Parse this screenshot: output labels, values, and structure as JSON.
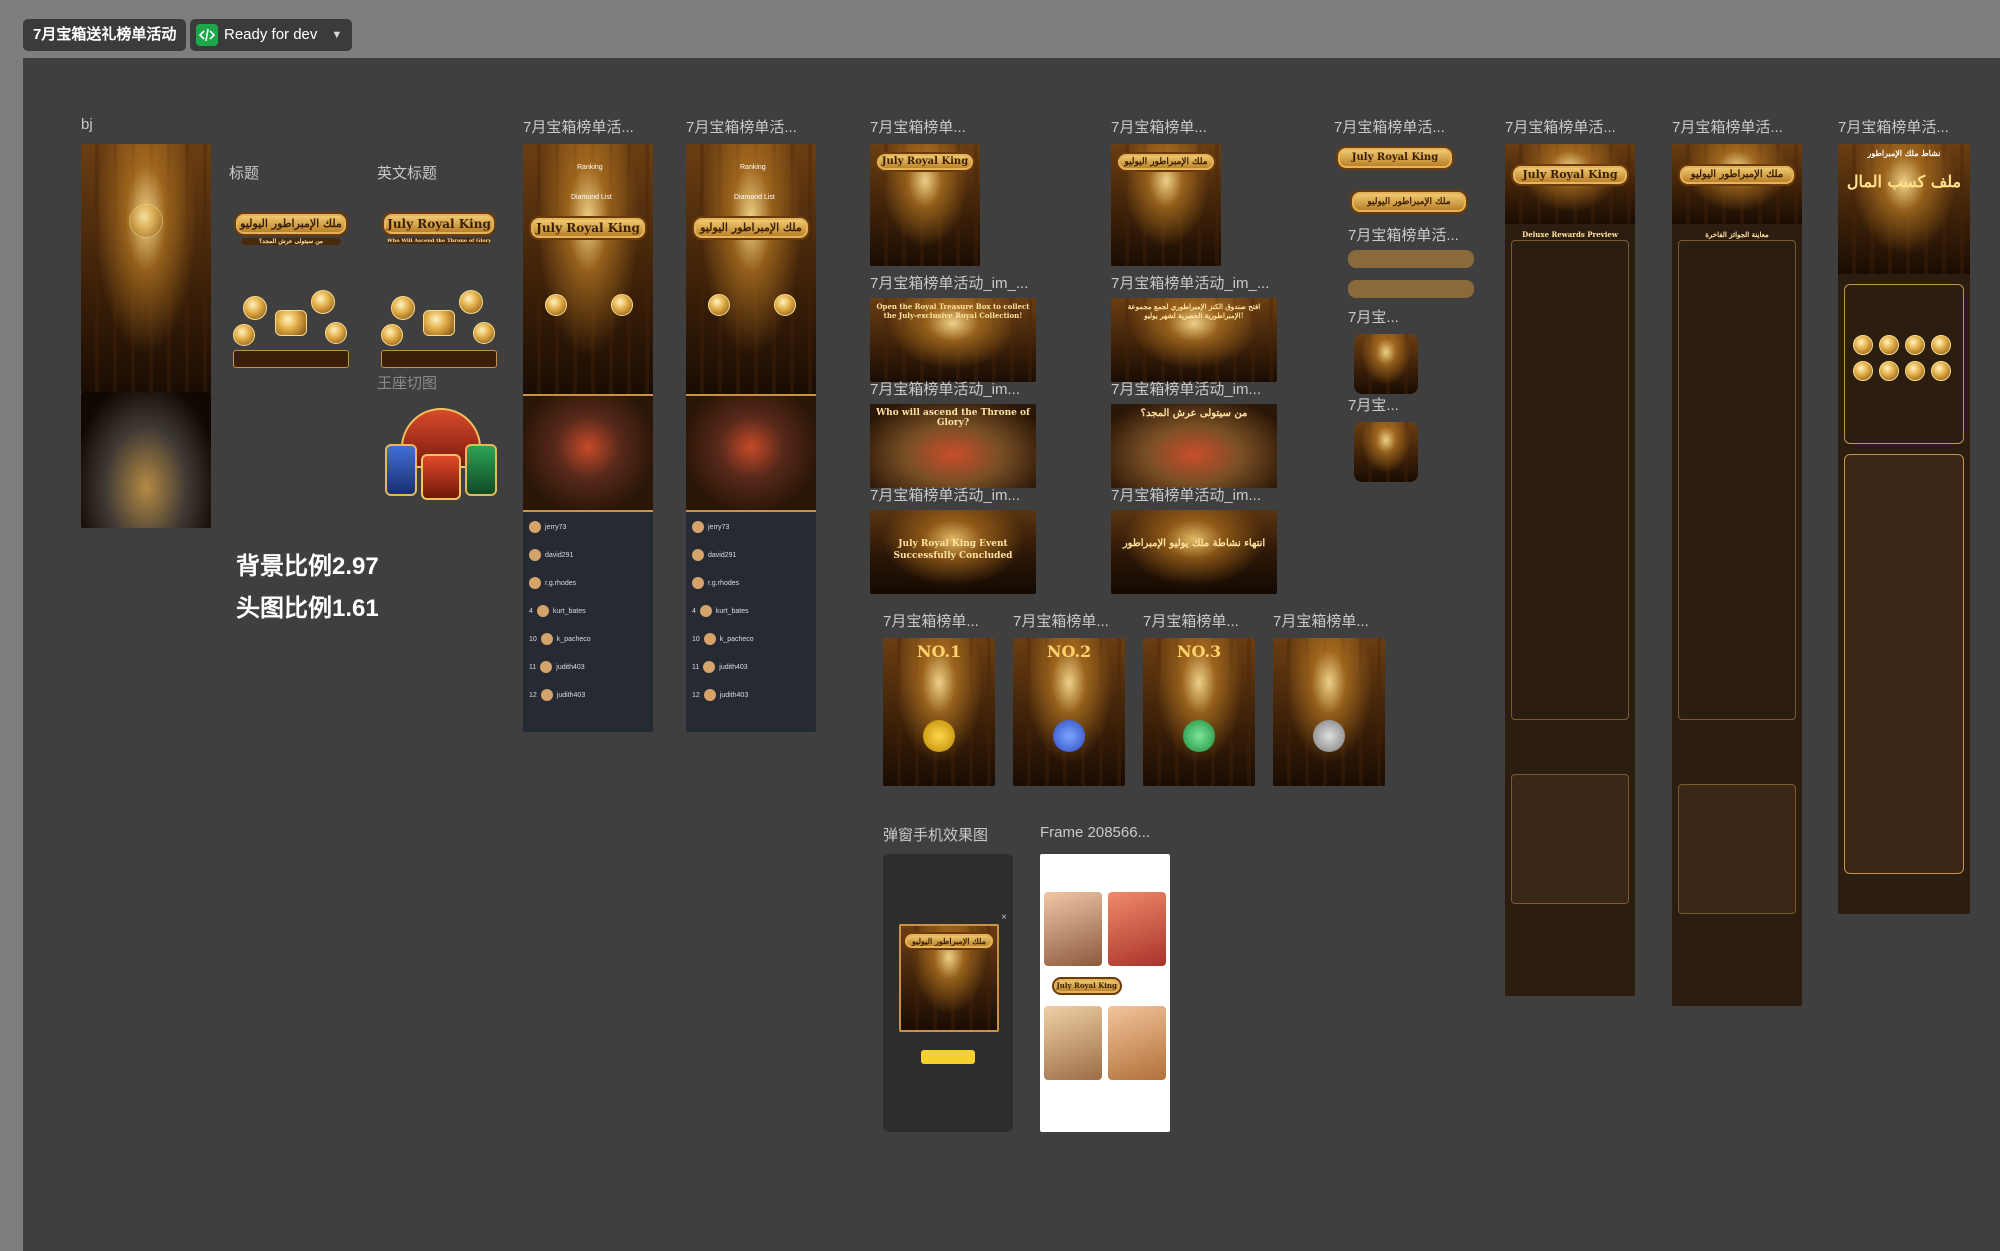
{
  "header": {
    "page_name": "7月宝箱送礼榜单活动",
    "status": "Ready for dev"
  },
  "colors": {
    "toolbar_bg": "#7e7e7e",
    "canvas_bg": "#3f3f3f",
    "chip_bg": "#3b3b3b",
    "status_green": "#1fa84a",
    "gold": "#e4b04a"
  },
  "labels": {
    "bj": "bj",
    "title_cn": "标题",
    "title_en": "英文标题",
    "throne": "王座切图",
    "bg_ratio": "背景比例2.97",
    "head_ratio": "头图比例1.61",
    "f1": "7月宝箱榜单活...",
    "f2": "7月宝箱榜单活...",
    "f3": "7月宝箱榜单...",
    "f4": "7月宝箱榜单...",
    "f5": "7月宝箱榜单活...",
    "f6": "7月宝箱榜单活...",
    "f7": "7月宝箱榜单活...",
    "f8": "7月宝箱榜单活...",
    "im1": "7月宝箱榜单活动_im_...",
    "im2": "7月宝箱榜单活动_im_...",
    "im3": "7月宝箱榜单活动_im...",
    "im4": "7月宝箱榜单活动_im...",
    "im5": "7月宝箱榜单活动_im...",
    "im6": "7月宝箱榜单活动_im...",
    "small1": "7月宝箱榜单活...",
    "small2": "7月宝箱榜单活...",
    "small3": "7月宝...",
    "small4": "7月宝...",
    "rank1_lbl": "7月宝箱榜单...",
    "rank2_lbl": "7月宝箱榜单...",
    "rank3_lbl": "7月宝箱榜单...",
    "rank4_lbl": "7月宝箱榜单...",
    "popup_lbl": "弹窗手机效果图",
    "frame_lbl": "Frame 208566..."
  },
  "artwork": {
    "en_title": "July Royal King",
    "ar_title": "ملك الإمبراطور اليوليو",
    "ar_sub": "من سيتولى عرش المجد؟",
    "en_sub": "Who Will Ascend the Throne of Glory?",
    "ranking": "Ranking",
    "diamond_list": "Diamond List",
    "open_box_en": "Open the Royal Treasure Box to collect the July-exclusive Royal Collection!",
    "open_box_ar": "افتح صندوق الكنز الإمبراطوري لجمع مجموعة الإمبراطورية الحصرية لشهر يوليو!",
    "ascend_en": "Who will ascend the Throne of Glory?",
    "ascend_ar": "من سيتولى عرش المجد؟",
    "concluded_en": "July Royal King Event Successfully Concluded",
    "concluded_ar": "انتهاء نشاطة ملك يوليو الإمبراطور",
    "no1": "NO.1",
    "no2": "NO.2",
    "no3": "NO.3",
    "rewards_en": "Deluxe Rewards Preview",
    "rewards_ar": "معاينة الجوائز الفاخرة",
    "long_title_ar": "ملف كسب المال",
    "long_sub_ar": "نشاط ملك الإمبراطور"
  },
  "leaderboard": {
    "rows": [
      {
        "rank": "",
        "name": "jerry73"
      },
      {
        "rank": "",
        "name": "david291"
      },
      {
        "rank": "",
        "name": "r.g.rhodes"
      },
      {
        "rank": "4",
        "name": "kurt_bates"
      },
      {
        "rank": "10",
        "name": "k_pacheco"
      },
      {
        "rank": "11",
        "name": "judith403"
      },
      {
        "rank": "12",
        "name": "judith403"
      }
    ]
  }
}
